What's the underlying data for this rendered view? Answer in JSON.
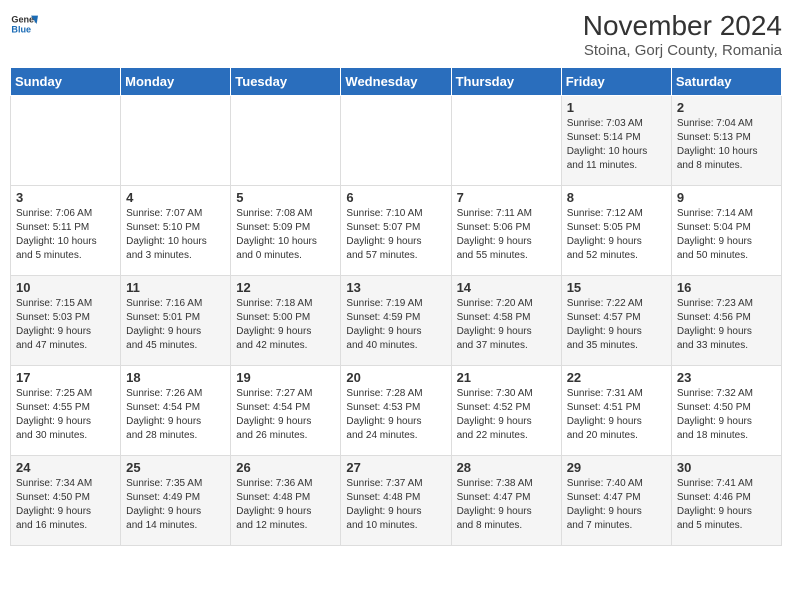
{
  "logo": {
    "general": "General",
    "blue": "Blue"
  },
  "title": "November 2024",
  "subtitle": "Stoina, Gorj County, Romania",
  "headers": [
    "Sunday",
    "Monday",
    "Tuesday",
    "Wednesday",
    "Thursday",
    "Friday",
    "Saturday"
  ],
  "weeks": [
    [
      {
        "day": "",
        "info": ""
      },
      {
        "day": "",
        "info": ""
      },
      {
        "day": "",
        "info": ""
      },
      {
        "day": "",
        "info": ""
      },
      {
        "day": "",
        "info": ""
      },
      {
        "day": "1",
        "info": "Sunrise: 7:03 AM\nSunset: 5:14 PM\nDaylight: 10 hours\nand 11 minutes."
      },
      {
        "day": "2",
        "info": "Sunrise: 7:04 AM\nSunset: 5:13 PM\nDaylight: 10 hours\nand 8 minutes."
      }
    ],
    [
      {
        "day": "3",
        "info": "Sunrise: 7:06 AM\nSunset: 5:11 PM\nDaylight: 10 hours\nand 5 minutes."
      },
      {
        "day": "4",
        "info": "Sunrise: 7:07 AM\nSunset: 5:10 PM\nDaylight: 10 hours\nand 3 minutes."
      },
      {
        "day": "5",
        "info": "Sunrise: 7:08 AM\nSunset: 5:09 PM\nDaylight: 10 hours\nand 0 minutes."
      },
      {
        "day": "6",
        "info": "Sunrise: 7:10 AM\nSunset: 5:07 PM\nDaylight: 9 hours\nand 57 minutes."
      },
      {
        "day": "7",
        "info": "Sunrise: 7:11 AM\nSunset: 5:06 PM\nDaylight: 9 hours\nand 55 minutes."
      },
      {
        "day": "8",
        "info": "Sunrise: 7:12 AM\nSunset: 5:05 PM\nDaylight: 9 hours\nand 52 minutes."
      },
      {
        "day": "9",
        "info": "Sunrise: 7:14 AM\nSunset: 5:04 PM\nDaylight: 9 hours\nand 50 minutes."
      }
    ],
    [
      {
        "day": "10",
        "info": "Sunrise: 7:15 AM\nSunset: 5:03 PM\nDaylight: 9 hours\nand 47 minutes."
      },
      {
        "day": "11",
        "info": "Sunrise: 7:16 AM\nSunset: 5:01 PM\nDaylight: 9 hours\nand 45 minutes."
      },
      {
        "day": "12",
        "info": "Sunrise: 7:18 AM\nSunset: 5:00 PM\nDaylight: 9 hours\nand 42 minutes."
      },
      {
        "day": "13",
        "info": "Sunrise: 7:19 AM\nSunset: 4:59 PM\nDaylight: 9 hours\nand 40 minutes."
      },
      {
        "day": "14",
        "info": "Sunrise: 7:20 AM\nSunset: 4:58 PM\nDaylight: 9 hours\nand 37 minutes."
      },
      {
        "day": "15",
        "info": "Sunrise: 7:22 AM\nSunset: 4:57 PM\nDaylight: 9 hours\nand 35 minutes."
      },
      {
        "day": "16",
        "info": "Sunrise: 7:23 AM\nSunset: 4:56 PM\nDaylight: 9 hours\nand 33 minutes."
      }
    ],
    [
      {
        "day": "17",
        "info": "Sunrise: 7:25 AM\nSunset: 4:55 PM\nDaylight: 9 hours\nand 30 minutes."
      },
      {
        "day": "18",
        "info": "Sunrise: 7:26 AM\nSunset: 4:54 PM\nDaylight: 9 hours\nand 28 minutes."
      },
      {
        "day": "19",
        "info": "Sunrise: 7:27 AM\nSunset: 4:54 PM\nDaylight: 9 hours\nand 26 minutes."
      },
      {
        "day": "20",
        "info": "Sunrise: 7:28 AM\nSunset: 4:53 PM\nDaylight: 9 hours\nand 24 minutes."
      },
      {
        "day": "21",
        "info": "Sunrise: 7:30 AM\nSunset: 4:52 PM\nDaylight: 9 hours\nand 22 minutes."
      },
      {
        "day": "22",
        "info": "Sunrise: 7:31 AM\nSunset: 4:51 PM\nDaylight: 9 hours\nand 20 minutes."
      },
      {
        "day": "23",
        "info": "Sunrise: 7:32 AM\nSunset: 4:50 PM\nDaylight: 9 hours\nand 18 minutes."
      }
    ],
    [
      {
        "day": "24",
        "info": "Sunrise: 7:34 AM\nSunset: 4:50 PM\nDaylight: 9 hours\nand 16 minutes."
      },
      {
        "day": "25",
        "info": "Sunrise: 7:35 AM\nSunset: 4:49 PM\nDaylight: 9 hours\nand 14 minutes."
      },
      {
        "day": "26",
        "info": "Sunrise: 7:36 AM\nSunset: 4:48 PM\nDaylight: 9 hours\nand 12 minutes."
      },
      {
        "day": "27",
        "info": "Sunrise: 7:37 AM\nSunset: 4:48 PM\nDaylight: 9 hours\nand 10 minutes."
      },
      {
        "day": "28",
        "info": "Sunrise: 7:38 AM\nSunset: 4:47 PM\nDaylight: 9 hours\nand 8 minutes."
      },
      {
        "day": "29",
        "info": "Sunrise: 7:40 AM\nSunset: 4:47 PM\nDaylight: 9 hours\nand 7 minutes."
      },
      {
        "day": "30",
        "info": "Sunrise: 7:41 AM\nSunset: 4:46 PM\nDaylight: 9 hours\nand 5 minutes."
      }
    ]
  ]
}
